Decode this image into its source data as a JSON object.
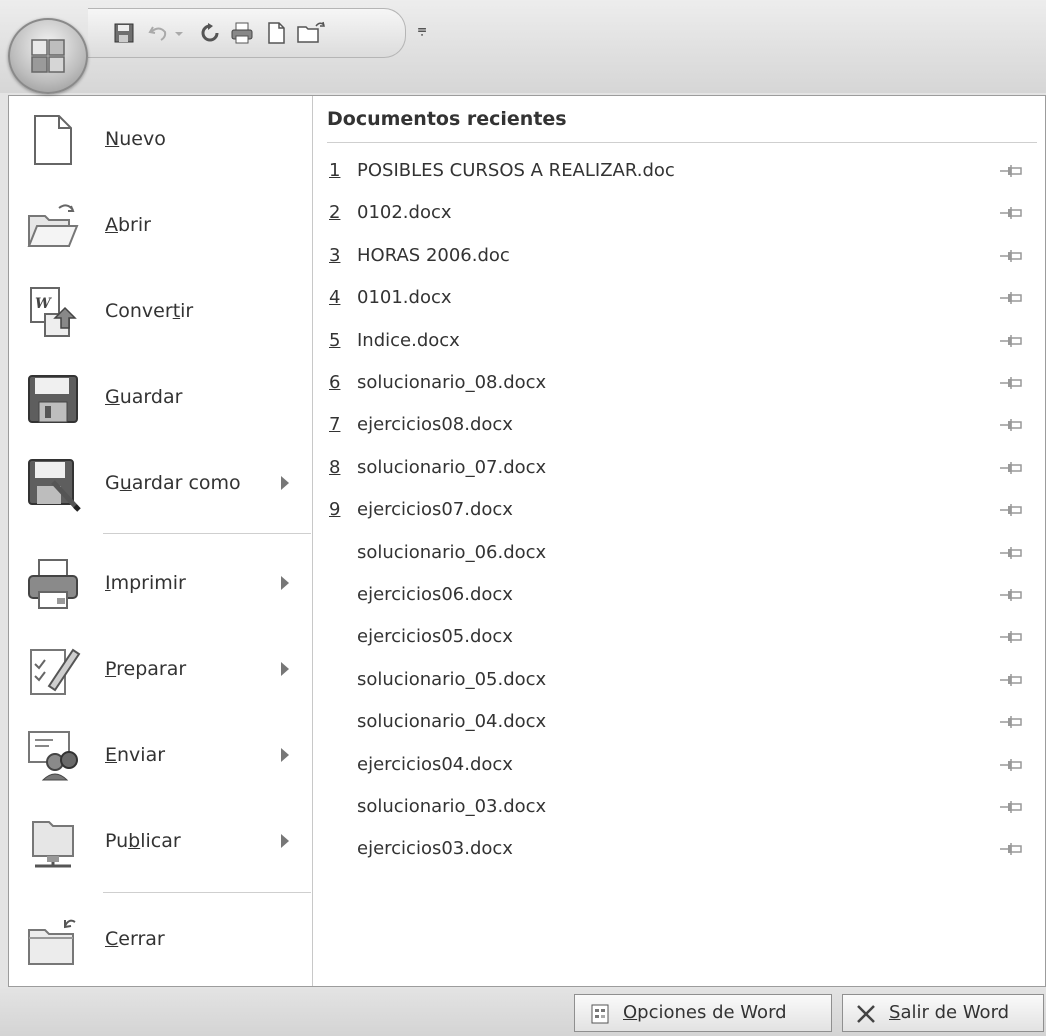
{
  "quick_access": {
    "icons": [
      "save-icon",
      "undo-icon",
      "redo-icon",
      "print-icon",
      "new-document-icon",
      "open-icon",
      "customize-toolbar-icon"
    ],
    "customize_glyph": "⩦"
  },
  "left_menu": {
    "items": [
      {
        "before": "",
        "mnemonic": "N",
        "after": "uevo",
        "icon": "new-document-icon",
        "submenu": false
      },
      {
        "before": "",
        "mnemonic": "A",
        "after": "brir",
        "icon": "open-folder-icon",
        "submenu": false
      },
      {
        "before": "Conver",
        "mnemonic": "t",
        "after": "ir",
        "icon": "convert-icon",
        "submenu": false
      },
      {
        "before": "",
        "mnemonic": "G",
        "after": "uardar",
        "icon": "save-disk-icon",
        "submenu": false
      },
      {
        "before": "G",
        "mnemonic": "u",
        "after": "ardar como",
        "icon": "save-as-icon",
        "submenu": true
      },
      {
        "before": "",
        "mnemonic": "I",
        "after": "mprimir",
        "icon": "printer-icon",
        "submenu": true
      },
      {
        "before": "",
        "mnemonic": "P",
        "after": "reparar",
        "icon": "prepare-icon",
        "submenu": true
      },
      {
        "before": "",
        "mnemonic": "E",
        "after": "nviar",
        "icon": "send-icon",
        "submenu": true
      },
      {
        "before": "Pu",
        "mnemonic": "b",
        "after": "licar",
        "icon": "publish-icon",
        "submenu": true
      },
      {
        "before": "",
        "mnemonic": "C",
        "after": "errar",
        "icon": "close-folder-icon",
        "submenu": false
      }
    ]
  },
  "recent_documents": {
    "title": "Documentos recientes",
    "items": [
      {
        "num": "1",
        "name": "POSIBLES CURSOS A REALIZAR.doc"
      },
      {
        "num": "2",
        "name": "0102.docx"
      },
      {
        "num": "3",
        "name": "HORAS 2006.doc"
      },
      {
        "num": "4",
        "name": "0101.docx"
      },
      {
        "num": "5",
        "name": "Indice.docx"
      },
      {
        "num": "6",
        "name": "solucionario_08.docx"
      },
      {
        "num": "7",
        "name": "ejercicios08.docx"
      },
      {
        "num": "8",
        "name": "solucionario_07.docx"
      },
      {
        "num": "9",
        "name": "ejercicios07.docx"
      },
      {
        "num": "",
        "name": "solucionario_06.docx"
      },
      {
        "num": "",
        "name": "ejercicios06.docx"
      },
      {
        "num": "",
        "name": "ejercicios05.docx"
      },
      {
        "num": "",
        "name": "solucionario_05.docx"
      },
      {
        "num": "",
        "name": "solucionario_04.docx"
      },
      {
        "num": "",
        "name": "ejercicios04.docx"
      },
      {
        "num": "",
        "name": "solucionario_03.docx"
      },
      {
        "num": "",
        "name": "ejercicios03.docx"
      }
    ]
  },
  "bottom": {
    "options": {
      "mnemonic": "O",
      "after": "pciones de Word"
    },
    "exit": {
      "mnemonic": "S",
      "after": "alir de Word"
    }
  }
}
